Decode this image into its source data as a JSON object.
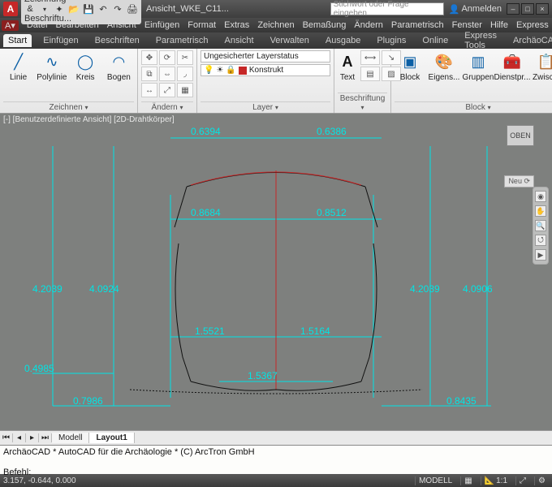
{
  "title": {
    "workspace": "Zeichnung & Beschriftu...",
    "document": "Ansicht_WKE_C11..."
  },
  "search_placeholder": "Stichwort oder Frage eingeben",
  "login_label": "Anmelden",
  "menu": [
    "Datei",
    "Bearbeiten",
    "Ansicht",
    "Einfügen",
    "Format",
    "Extras",
    "Zeichnen",
    "Bemaßung",
    "Ändern",
    "Parametrisch",
    "Fenster",
    "Hilfe",
    "Express"
  ],
  "tabs": [
    "Start",
    "Einfügen",
    "Beschriften",
    "Parametrisch",
    "Ansicht",
    "Verwalten",
    "Ausgabe",
    "Plugins",
    "Online",
    "Express Tools",
    "ArchäoCAD"
  ],
  "active_tab": 0,
  "ribbon": {
    "draw": {
      "title": "Zeichnen",
      "items": [
        "Linie",
        "Polylinie",
        "Kreis",
        "Bogen"
      ]
    },
    "modify": {
      "title": "Ändern"
    },
    "layer": {
      "title": "Layer",
      "row1": "Ungesicherter Layerstatus",
      "row2": "Konstrukt",
      "row2_color": "#c62828"
    },
    "annot": {
      "title": "Beschriftung",
      "text_label": "Text"
    },
    "block": {
      "title": "Block",
      "items": [
        "Block",
        "Eigens...",
        "Gruppen",
        "Dienstpr...",
        "Zwisc..."
      ]
    }
  },
  "viewport_label": "[-] [Benutzerdefinierte Ansicht] [2D-Drahtkörper]",
  "viewcube": "OBEN",
  "neu_label": "Neu",
  "dimensions": {
    "top_left": "0.6394",
    "top_right": "0.6386",
    "mid_left": "0.8684",
    "mid_right": "0.8512",
    "h_outer_left": "4.2039",
    "h_inner_left": "4.0924",
    "h_inner_right": "4.2039",
    "h_outer_right": "4.0906",
    "low_left": "1.5521",
    "low_right": "1.5164",
    "bot_small": "1.5367",
    "bl1": "0.4985",
    "bl2": "0.7986",
    "br": "0.8435"
  },
  "sheets": {
    "items": [
      "Modell",
      "Layout1"
    ],
    "active": 1
  },
  "command": {
    "line1": "ArchäoCAD * AutoCAD für die Archäologie * (C) ArcTron GmbH",
    "prompt": "Befehl:"
  },
  "status": {
    "coords": "3.157, -0.644, 0.000",
    "model": "MODELL",
    "scale": "1:1"
  }
}
